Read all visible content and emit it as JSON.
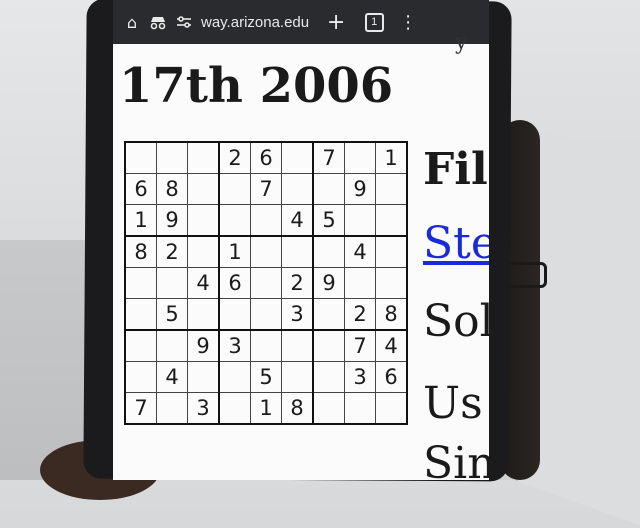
{
  "browser": {
    "url": "way.arizona.edu",
    "tab_count": "1",
    "icons": [
      "home-icon",
      "incognito-icon",
      "site-settings-icon",
      "plus-icon",
      "tabs-icon",
      "menu-icon"
    ]
  },
  "page": {
    "title": "17th 2006",
    "title_stub": "y",
    "side_texts": {
      "file": "Fil",
      "link": "Ste",
      "solution": "Sol",
      "use": "Us",
      "sim": "Sin"
    }
  },
  "sudoku": {
    "rows": [
      [
        "",
        "",
        "",
        "2",
        "6",
        "",
        "7",
        "",
        "1"
      ],
      [
        "6",
        "8",
        "",
        "",
        "7",
        "",
        "",
        "9",
        ""
      ],
      [
        "1",
        "9",
        "",
        "",
        "",
        "4",
        "5",
        "",
        ""
      ],
      [
        "8",
        "2",
        "",
        "1",
        "",
        "",
        "",
        "4",
        ""
      ],
      [
        "",
        "",
        "4",
        "6",
        "",
        "2",
        "9",
        "",
        ""
      ],
      [
        "",
        "5",
        "",
        "",
        "",
        "3",
        "",
        "2",
        "8"
      ],
      [
        "",
        "",
        "9",
        "3",
        "",
        "",
        "",
        "7",
        "4"
      ],
      [
        "",
        "4",
        "",
        "",
        "5",
        "",
        "",
        "3",
        "6"
      ],
      [
        "7",
        "",
        "3",
        "",
        "1",
        "8",
        "",
        "",
        ""
      ]
    ]
  },
  "colors": {
    "toolbar": "#2a2b2e",
    "link": "#1a2ad8",
    "page_bg": "#fbfbfb"
  }
}
